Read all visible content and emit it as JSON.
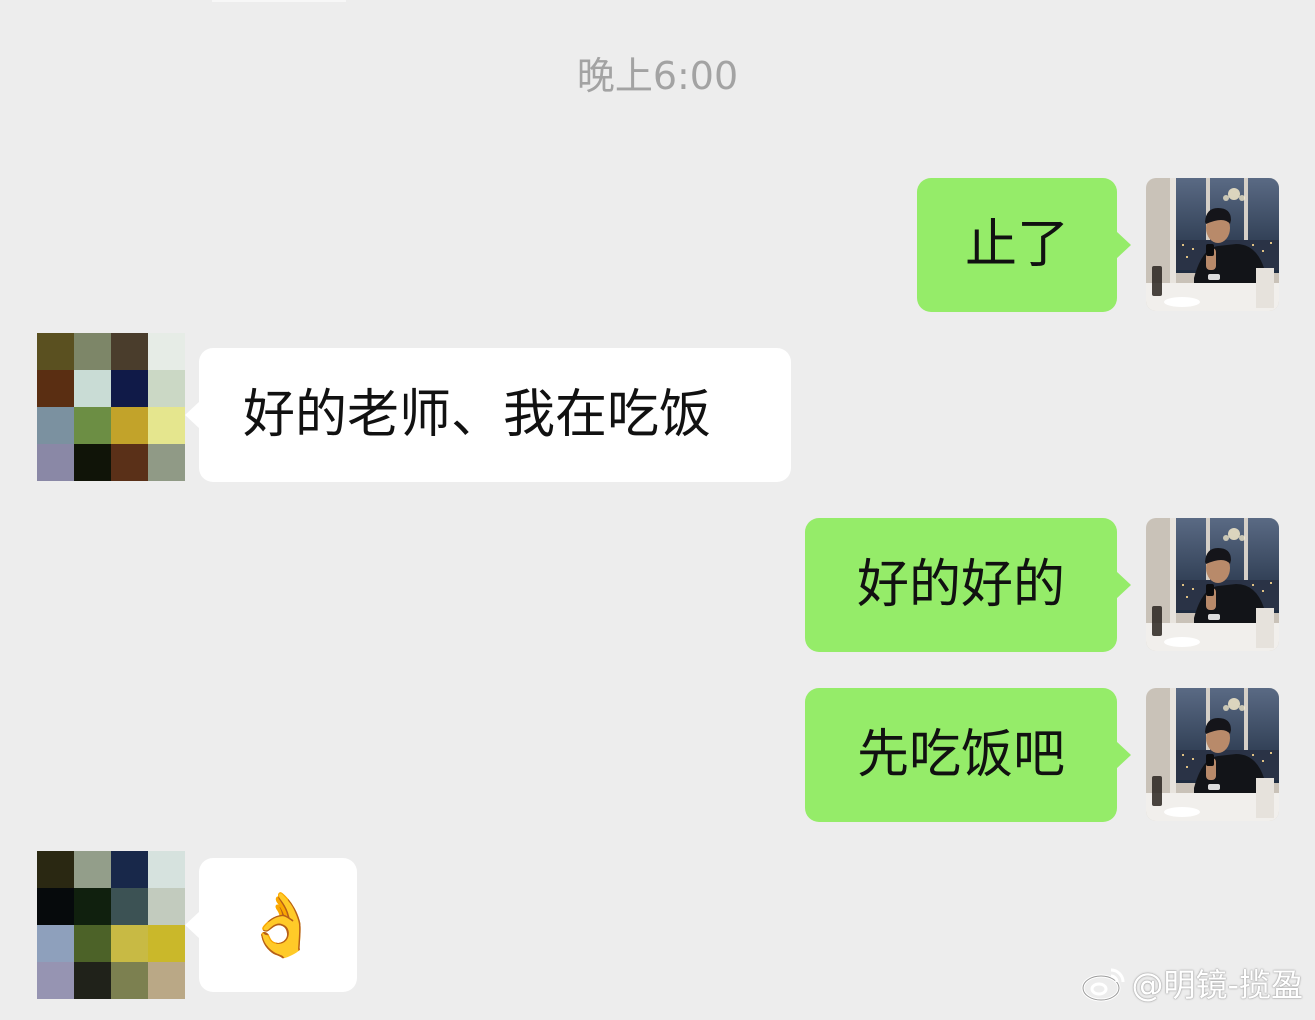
{
  "chat": {
    "timestamp": "晚上6:00",
    "messages": [
      {
        "side": "out",
        "text": "止了"
      },
      {
        "side": "in",
        "text": "好的老师、我在吃饭"
      },
      {
        "side": "out",
        "text": "好的好的"
      },
      {
        "side": "out",
        "text": "先吃饭吧"
      },
      {
        "side": "in",
        "text": "👌"
      }
    ]
  },
  "watermark": {
    "icon": "weibo-icon",
    "text": "@明镜-揽盈"
  },
  "colors": {
    "background": "#ededed",
    "out_bubble": "#95ec69",
    "in_bubble": "#ffffff",
    "timestamp_text": "#a3a3a3"
  },
  "avatars": {
    "self": "photo-avatar-icon",
    "contact": "pixelated-avatar-icon",
    "contact_mosaic_1": [
      "#5a5020",
      "#7d8668",
      "#4a3d2c",
      "#e6ece6",
      "#5a2e12",
      "#c9dcd5",
      "#101a48",
      "#cbd8c5",
      "#7b91a0",
      "#6c8e44",
      "#c2a32a",
      "#e5e68e",
      "#8a88a6",
      "#101408",
      "#5a3018",
      "#909a86"
    ],
    "contact_mosaic_2": [
      "#2a2812",
      "#939e8a",
      "#18284a",
      "#d6e2de",
      "#060a0c",
      "#10200e",
      "#3c5254",
      "#c2cbbe",
      "#8ea0bc",
      "#4c6228",
      "#c8ba44",
      "#cab82a",
      "#9694b2",
      "#20221a",
      "#7c8050",
      "#baa886"
    ]
  }
}
